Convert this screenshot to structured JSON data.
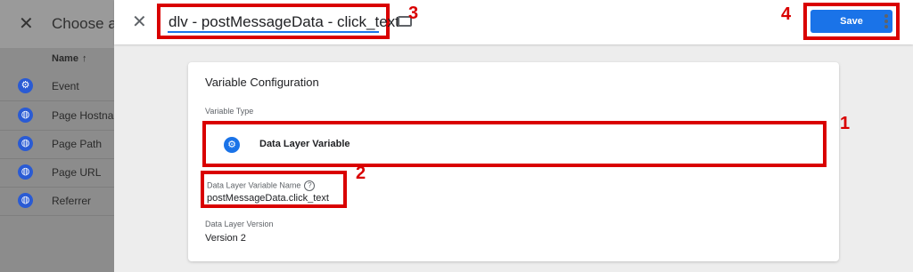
{
  "background": {
    "title": "Choose a",
    "column_header": "Name",
    "sort_icon": "arrow-up-icon",
    "rows": [
      {
        "label": "Event",
        "icon": "gear-icon"
      },
      {
        "label": "Page Hostnar",
        "icon": "globe-icon"
      },
      {
        "label": "Page Path",
        "icon": "globe-icon"
      },
      {
        "label": "Page URL",
        "icon": "globe-icon"
      },
      {
        "label": "Referrer",
        "icon": "globe-icon"
      }
    ]
  },
  "header": {
    "variable_name": "dlv - postMessageData - click_text",
    "save_label": "Save"
  },
  "card": {
    "title": "Variable Configuration",
    "variable_type_label": "Variable Type",
    "variable_type": "Data Layer Variable",
    "dlv_name_label": "Data Layer Variable Name",
    "dlv_name_value": "postMessageData.click_text",
    "version_label": "Data Layer Version",
    "version_value": "Version 2"
  },
  "annotations": {
    "one": "1",
    "two": "2",
    "three": "3",
    "four": "4"
  },
  "colors": {
    "accent": "#1a73e8",
    "highlight": "#d90000"
  }
}
